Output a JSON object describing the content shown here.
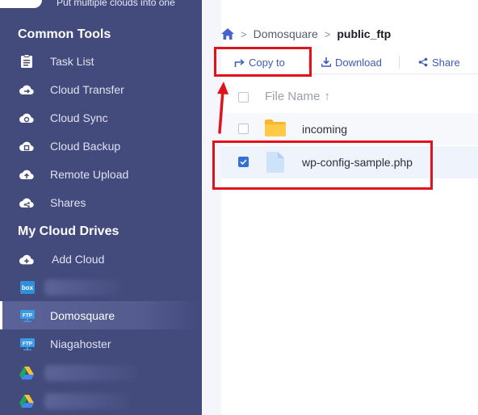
{
  "sidebar": {
    "tagline": "Put multiple clouds into one",
    "common_tools_title": "Common Tools",
    "tools": [
      {
        "label": "Task List",
        "icon": "clipboard-icon"
      },
      {
        "label": "Cloud Transfer",
        "icon": "cloud-transfer-icon"
      },
      {
        "label": "Cloud Sync",
        "icon": "cloud-sync-icon"
      },
      {
        "label": "Cloud Backup",
        "icon": "cloud-backup-icon"
      },
      {
        "label": "Remote Upload",
        "icon": "cloud-upload-icon"
      },
      {
        "label": "Shares",
        "icon": "share-cloud-icon"
      }
    ],
    "my_drives_title": "My Cloud Drives",
    "add_cloud_label": "Add Cloud",
    "drives": [
      {
        "label": "",
        "icon": "box-icon"
      },
      {
        "label": "Domosquare",
        "icon": "ftp-icon",
        "active": true
      },
      {
        "label": "Niagahoster",
        "icon": "ftp-icon"
      },
      {
        "label": "",
        "icon": "google-drive-icon"
      },
      {
        "label": "",
        "icon": "google-drive-icon"
      }
    ],
    "ftp_badge": "FTP",
    "box_badge": "box"
  },
  "breadcrumb": {
    "home_icon": "home-icon",
    "items": [
      "Domosquare",
      "public_ftp"
    ]
  },
  "toolbar": {
    "copy_to": "Copy to",
    "download": "Download",
    "share": "Share"
  },
  "file_list": {
    "column_name": "File Name",
    "sort_indicator": "↑",
    "rows": [
      {
        "name": "incoming",
        "type": "folder",
        "checked": false
      },
      {
        "name": "wp-config-sample.php",
        "type": "file",
        "checked": true
      }
    ]
  },
  "colors": {
    "sidebar_bg": "#434a7c",
    "accent": "#3470d9",
    "annotation": "#e0121b"
  }
}
